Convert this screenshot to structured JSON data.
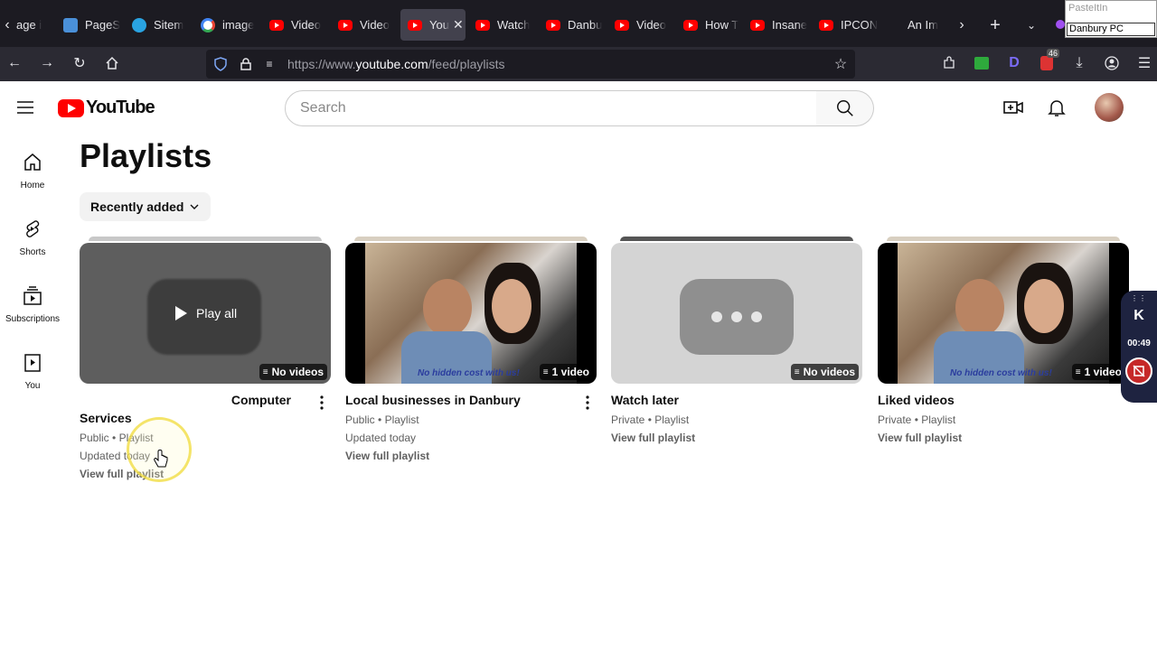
{
  "browser": {
    "tabs": [
      {
        "label": "age i",
        "icon": "page-icon"
      },
      {
        "label": "PageS",
        "icon": "pagespeed-icon"
      },
      {
        "label": "Sitem",
        "icon": "globe-icon"
      },
      {
        "label": "image",
        "icon": "google-icon"
      },
      {
        "label": "Video",
        "icon": "youtube-icon"
      },
      {
        "label": "Video",
        "icon": "youtube-icon"
      },
      {
        "label": "You",
        "icon": "youtube-icon",
        "active": true
      },
      {
        "label": "Watch",
        "icon": "youtube-icon"
      },
      {
        "label": "Danbu",
        "icon": "youtube-icon"
      },
      {
        "label": "Video",
        "icon": "youtube-icon"
      },
      {
        "label": "How T",
        "icon": "youtube-icon"
      },
      {
        "label": "Insane",
        "icon": "youtube-icon"
      },
      {
        "label": "IPCON",
        "icon": "youtube-icon"
      },
      {
        "label": "An Im",
        "icon": "none"
      }
    ],
    "url_prefix": "https://www.",
    "url_host": "youtube.com",
    "url_path": "/feed/playlists",
    "extension_badge": "46"
  },
  "paste_window": {
    "title": "PasteItIn",
    "value": "Danbury PC"
  },
  "youtube": {
    "logo_text": "YouTube",
    "search_placeholder": "Search",
    "guide": [
      {
        "label": "Home",
        "icon": "home-icon"
      },
      {
        "label": "Shorts",
        "icon": "shorts-icon"
      },
      {
        "label": "Subscriptions",
        "icon": "subscriptions-icon"
      },
      {
        "label": "You",
        "icon": "you-icon"
      }
    ],
    "page_title": "Playlists",
    "sort_chip": "Recently added",
    "playlists": [
      {
        "title_line1": "Computer",
        "title_line2": "Services",
        "visibility": "Public",
        "type": "Playlist",
        "updated": "Updated today",
        "link": "View full playlist",
        "badge": "No videos",
        "hover_label": "Play all"
      },
      {
        "title_line1": "Local businesses in Danbury",
        "visibility": "Public",
        "type": "Playlist",
        "updated": "Updated today",
        "link": "View full playlist",
        "badge": "1 video",
        "watermark": "No hidden cost with us!"
      },
      {
        "title_line1": "Watch later",
        "visibility": "Private",
        "type": "Playlist",
        "link": "View full playlist",
        "badge": "No videos"
      },
      {
        "title_line1": "Liked videos",
        "visibility": "Private",
        "type": "Playlist",
        "link": "View full playlist",
        "badge": "1 video",
        "watermark": "No hidden cost with us!"
      }
    ],
    "meta_separator": "•"
  },
  "recorder": {
    "logo": "K",
    "time": "00:49"
  }
}
